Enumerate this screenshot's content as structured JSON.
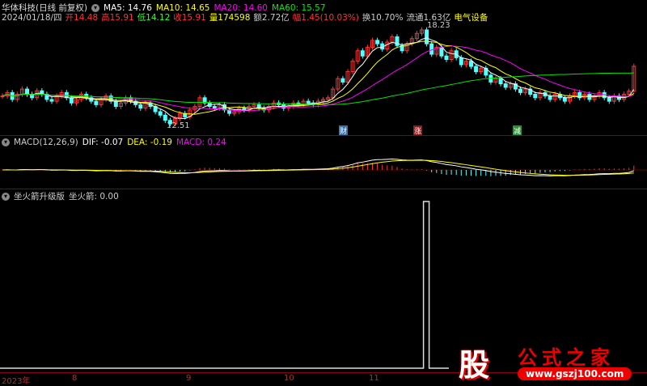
{
  "header": {
    "title": "华体科技(日线 前复权)",
    "ma5": "MA5: 14.76",
    "ma10": "MA10: 14.65",
    "ma20": "MA20: 14.60",
    "ma60": "MA60: 15.57",
    "date": "2024/01/18/四",
    "open": "开14.48",
    "high": "高15.91",
    "low": "低14.12",
    "close": "收15.91",
    "vol": "量174598",
    "amount": "额2.72亿",
    "change": "幅1.45(10.03%)",
    "turnover": "换10.70%",
    "float": "流通1.63亿",
    "sector": "电气设备"
  },
  "price_labels": {
    "high": "18.23",
    "low": "12.51"
  },
  "markers": [
    {
      "label": "财",
      "color": "#3a6fa8"
    },
    {
      "label": "涨",
      "color": "#8b1a1a"
    },
    {
      "label": "减",
      "color": "#2e8b3a"
    }
  ],
  "macd": {
    "title": "MACD(12,26,9)",
    "dif": "DIF: -0.07",
    "dea": "DEA: -0.19",
    "macd": "MACD: 0.24"
  },
  "rocket": {
    "title": "坐火箭升级版",
    "value": "坐火箭: 0.00",
    "signal_index": 86
  },
  "axis": [
    "2023年",
    "8",
    "9",
    "10",
    "11"
  ],
  "watermark": {
    "logo": "股",
    "name": "公式之家",
    "url": "www.gszj100.com"
  },
  "colors": {
    "up": "#ff3232",
    "down": "#54ffff",
    "ma5": "#ffffff",
    "ma10": "#ffff00",
    "ma20": "#ff00ff",
    "ma60": "#00e600"
  },
  "closes": [
    14.2,
    14.4,
    14.0,
    14.3,
    14.6,
    14.3,
    14.1,
    14.5,
    14.3,
    14.0,
    13.9,
    14.2,
    14.4,
    14.1,
    13.8,
    14.0,
    14.3,
    14.1,
    13.9,
    13.7,
    14.0,
    14.2,
    13.9,
    13.6,
    13.8,
    14.1,
    13.9,
    13.7,
    13.5,
    13.8,
    13.6,
    13.3,
    13.1,
    12.8,
    12.6,
    12.9,
    13.2,
    13.0,
    13.4,
    13.6,
    14.1,
    13.8,
    13.6,
    13.5,
    13.7,
    13.4,
    13.2,
    13.3,
    13.5,
    13.4,
    13.6,
    13.7,
    13.5,
    13.4,
    13.6,
    13.8,
    13.7,
    13.5,
    13.6,
    13.8,
    13.7,
    13.9,
    13.8,
    13.7,
    13.9,
    14.0,
    14.1,
    14.6,
    15.2,
    15.0,
    15.6,
    16.2,
    16.8,
    16.5,
    17.0,
    17.4,
    17.2,
    16.9,
    17.3,
    17.6,
    17.1,
    16.8,
    17.2,
    17.5,
    17.8,
    18.0,
    17.2,
    16.6,
    17.0,
    16.5,
    16.3,
    16.8,
    16.4,
    16.0,
    16.2,
    15.9,
    15.6,
    15.8,
    15.4,
    15.0,
    15.2,
    14.9,
    14.7,
    14.9,
    14.6,
    14.4,
    14.6,
    14.3,
    14.1,
    14.4,
    14.2,
    14.0,
    14.3,
    14.1,
    13.9,
    14.2,
    14.4,
    14.1,
    14.3,
    14.0,
    14.2,
    14.4,
    14.1,
    13.9,
    14.2,
    14.0,
    14.3,
    14.48,
    15.91
  ]
}
